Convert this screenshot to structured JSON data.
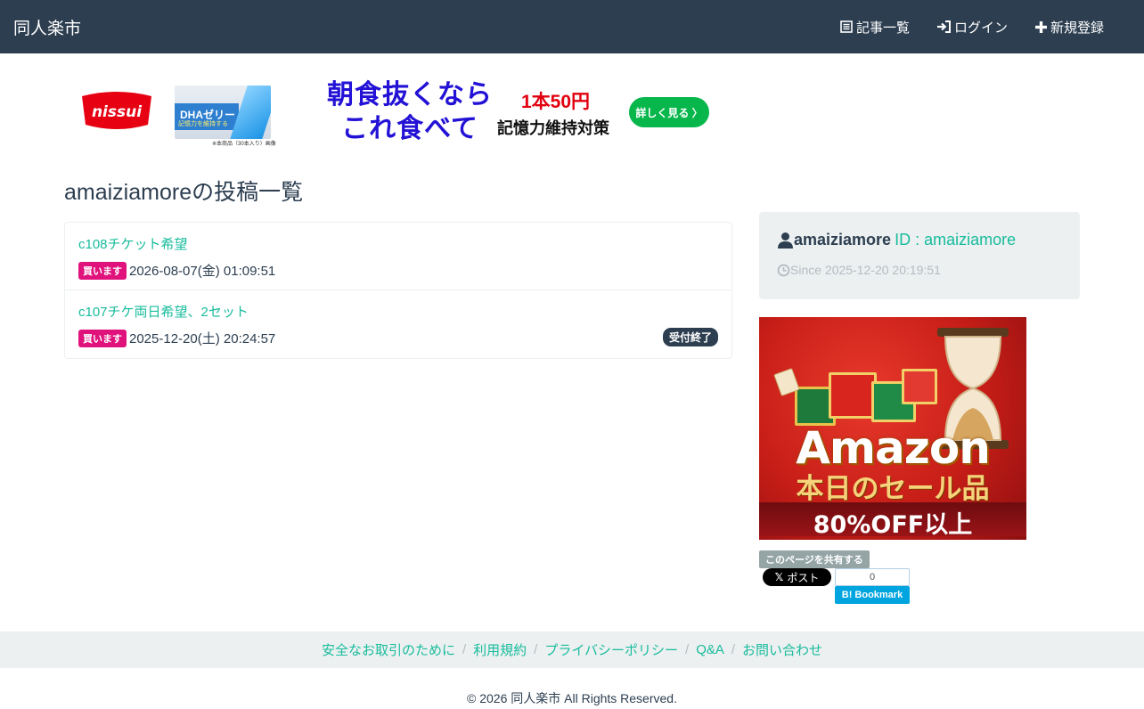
{
  "navbar": {
    "brand": "同人楽市",
    "links": [
      {
        "label": "記事一覧",
        "icon": "list-icon"
      },
      {
        "label": "ログイン",
        "icon": "login-icon"
      },
      {
        "label": "新規登録",
        "icon": "plus-icon"
      }
    ]
  },
  "banner": {
    "logo": "nissui",
    "product_band": "DHAゼリー",
    "product_band_sub": "記憶力を維持する",
    "product_caption": "※本商品（30本入り）画像",
    "headline_line1": "朝食抜くなら",
    "headline_line2": "これ食べて",
    "price": "1本50円",
    "subhead": "記憶力維持対策",
    "button": "詳しく見る 〉",
    "colors": {
      "headline": "#2312d6",
      "price": "#e1000e",
      "button": "#07b74b"
    }
  },
  "page": {
    "title": "amaiziamoreの投稿一覧"
  },
  "posts": [
    {
      "title": "c108チケット希望",
      "badge": "買います",
      "date": "2026-08-07(金) 01:09:51",
      "status": ""
    },
    {
      "title": "c107チケ両日希望、2セット",
      "badge": "買います",
      "date": "2025-12-20(土) 20:24:57",
      "status": "受付終了"
    }
  ],
  "profile": {
    "name": "amaiziamore",
    "id_label": "ID : amaiziamore",
    "since": "Since 2025-12-20 20:19:51"
  },
  "amazon_ad": {
    "word": "Amazon",
    "sub": "本日のセール品",
    "off": "80%OFF以上"
  },
  "share": {
    "label": "このページを共有する",
    "x_post": "ポスト",
    "hatena_count": "0",
    "hatena_button": "Bookmark"
  },
  "footer": {
    "links": [
      "安全なお取引のために",
      "利用規約",
      "プライバシーポリシー",
      "Q&A",
      "お問い合わせ"
    ],
    "separator": "/",
    "copyright": "© 2026 同人楽市 All Rights Reserved."
  },
  "colors": {
    "navbar": "#2c3e50",
    "accent": "#18bc9c",
    "badge_buy": "#e0127b",
    "panel": "#ecf0f1"
  }
}
